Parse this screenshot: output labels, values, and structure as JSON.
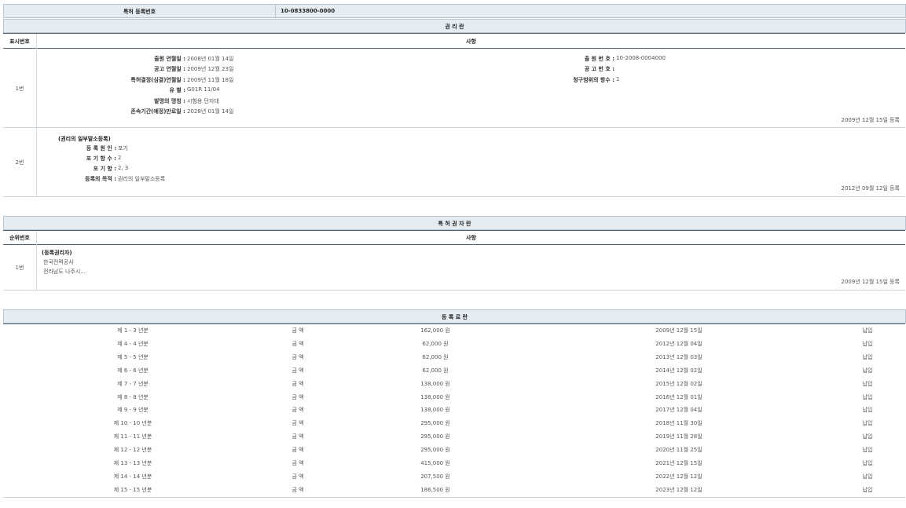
{
  "top": {
    "reg_label": "특허 등록번호",
    "reg_value": "10-0833800-0000"
  },
  "rights": {
    "title": "권 리 란",
    "col_no": "표시번호",
    "col_item": "사항",
    "row1": {
      "no": "1번",
      "left_labels": [
        "출원 연월일 :",
        "공고 연월일 :",
        "특허결정(심결)연월일 :",
        "유 별 :",
        "발명의 명칭 :",
        "존속기간(예정)만료일 :"
      ],
      "left_values": [
        "2008년 01월 14일",
        "2009년 12월 23일",
        "2009년 11월 18일",
        "G01R 11/04",
        "시험용 단자대",
        "2028년 01월 14일"
      ],
      "right_labels": [
        "출 원 번 호 :",
        "공 고 번 호 :",
        "청구범위의 항수 :"
      ],
      "right_values": [
        "10-2008-0004000",
        "",
        "1"
      ],
      "reg_date": "2009년 12월 15일 등록"
    },
    "row2": {
      "no": "2번",
      "heading": "(권리의 일부말소등록)",
      "labels": [
        "등 록 원 인 :",
        "포 기 항 수 :",
        "포 기 항 :",
        "등록의 목적 :"
      ],
      "values": [
        "포기",
        "2",
        "2, 3",
        "권리의 일부말소등록"
      ],
      "reg_date": "2012년 09월 12일 등록"
    }
  },
  "holder": {
    "title": "특 허 권 자 란",
    "col_no": "순위번호",
    "col_item": "사항",
    "row1": {
      "no": "1번",
      "heading": "(등록권리자)",
      "lines": [
        "한국전력공사",
        "전라남도 나주시..."
      ],
      "reg_date": "2009년 12월 15일 등록"
    }
  },
  "fees": {
    "title": "등 록 료 란",
    "rows": [
      {
        "period": "제 1 - 3 년분",
        "amount_label": "금 액",
        "amount": "162,000 원",
        "date": "2009년 12월 15일",
        "status": "납입"
      },
      {
        "period": "제 4 - 4 년분",
        "amount_label": "금 액",
        "amount": "62,000 원",
        "date": "2012년 12월 04일",
        "status": "납입"
      },
      {
        "period": "제 5 - 5 년분",
        "amount_label": "금 액",
        "amount": "62,000 원",
        "date": "2013년 12월 03일",
        "status": "납입"
      },
      {
        "period": "제 6 - 6 년분",
        "amount_label": "금 액",
        "amount": "62,000 원",
        "date": "2014년 12월 02일",
        "status": "납입"
      },
      {
        "period": "제 7 - 7 년분",
        "amount_label": "금 액",
        "amount": "138,000 원",
        "date": "2015년 12월 02일",
        "status": "납입"
      },
      {
        "period": "제 8 - 8 년분",
        "amount_label": "금 액",
        "amount": "138,000 원",
        "date": "2016년 12월 01일",
        "status": "납입"
      },
      {
        "period": "제 9 - 9 년분",
        "amount_label": "금 액",
        "amount": "138,000 원",
        "date": "2017년 12월 04일",
        "status": "납입"
      },
      {
        "period": "제 10 - 10 년분",
        "amount_label": "금 액",
        "amount": "295,000 원",
        "date": "2018년 11월 30일",
        "status": "납입"
      },
      {
        "period": "제 11 - 11 년분",
        "amount_label": "금 액",
        "amount": "295,000 원",
        "date": "2019년 11월 28일",
        "status": "납입"
      },
      {
        "period": "제 12 - 12 년분",
        "amount_label": "금 액",
        "amount": "295,000 원",
        "date": "2020년 11월 25일",
        "status": "납입"
      },
      {
        "period": "제 13 - 13 년분",
        "amount_label": "금 액",
        "amount": "415,000 원",
        "date": "2021년 12월 15일",
        "status": "납입"
      },
      {
        "period": "제 14 - 14 년분",
        "amount_label": "금 액",
        "amount": "207,500 원",
        "date": "2022년 12월 12일",
        "status": "납입"
      },
      {
        "period": "제 15 - 15 년분",
        "amount_label": "금 액",
        "amount": "186,500 원",
        "date": "2023년 12월 12일",
        "status": "납입"
      }
    ]
  }
}
